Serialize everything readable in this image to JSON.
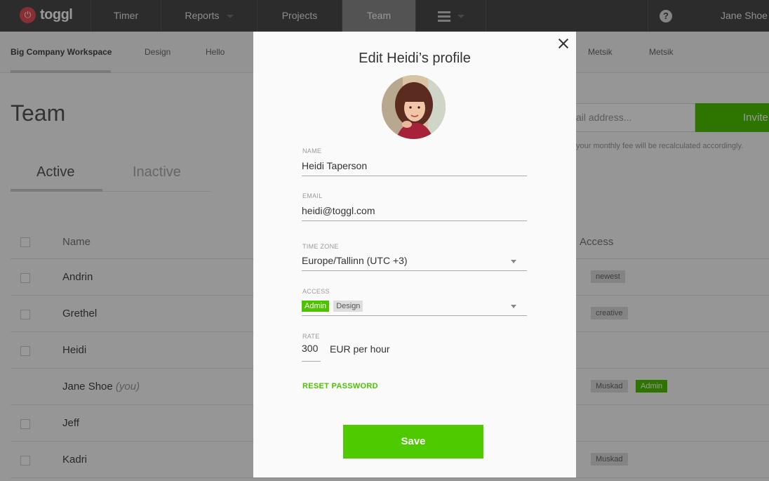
{
  "app": {
    "logo_text": "toggl",
    "brand_color": "#e24f54",
    "accent_color": "#4dc300"
  },
  "topnav": {
    "tabs": [
      {
        "label": "Timer"
      },
      {
        "label": "Reports"
      },
      {
        "label": "Projects"
      },
      {
        "label": "Team"
      }
    ],
    "active_tab": "Team",
    "help_icon": "?",
    "user_name": "Jane Shoe"
  },
  "workspaces": [
    "Big Company Workspace",
    "Design",
    "Hello",
    "Metsik",
    "Metsik"
  ],
  "page": {
    "title": "Team",
    "invite_placeholder": "ail address...",
    "invite_button": "Invite",
    "fee_note": "your monthly fee will be recalculated accordingly.",
    "tabs": {
      "active": "Active",
      "inactive": "Inactive"
    },
    "columns": {
      "name": "Name",
      "access": "Access"
    }
  },
  "members": [
    {
      "name": "Andrin",
      "you": "",
      "tags": [
        {
          "label": "newest",
          "style": "grey"
        }
      ]
    },
    {
      "name": "Grethel",
      "you": "",
      "tags": [
        {
          "label": "creative",
          "style": "grey"
        }
      ]
    },
    {
      "name": "Heidi",
      "you": "",
      "tags": []
    },
    {
      "name": "Jane Shoe",
      "you": "(you)",
      "tags": [
        {
          "label": "Muskad",
          "style": "grey"
        },
        {
          "label": "Admin",
          "style": "green"
        }
      ]
    },
    {
      "name": "Jeff",
      "you": "",
      "tags": []
    },
    {
      "name": "Kadri",
      "you": "",
      "tags": [
        {
          "label": "Muskad",
          "style": "grey"
        }
      ]
    }
  ],
  "modal": {
    "title": "Edit Heidi’s profile",
    "name_label": "NAME",
    "name_value": "Heidi Taperson",
    "email_label": "EMAIL",
    "email_value": "heidi@toggl.com",
    "timezone_label": "TIME ZONE",
    "timezone_value": "Europe/Tallinn (UTC +3)",
    "access_label": "ACCESS",
    "access_tags": [
      "Admin",
      "Design"
    ],
    "rate_label": "RATE",
    "rate_value": "300",
    "rate_unit": "EUR per hour",
    "reset_password": "RESET PASSWORD",
    "save_button": "Save"
  }
}
